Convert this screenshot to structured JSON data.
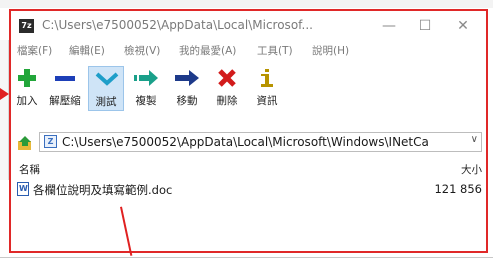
{
  "window": {
    "title": "C:\\Users\\e7500052\\AppData\\Local\\Microsof...",
    "app_icon_text": "7z",
    "minimize": "—",
    "maximize": "☐",
    "close": "✕"
  },
  "menu": {
    "items": [
      "檔案(F)",
      "編輯(E)",
      "檢視(V)",
      "我的最愛(A)",
      "工具(T)",
      "說明(H)"
    ]
  },
  "toolbar": {
    "buttons": [
      {
        "label": "加入",
        "icon": "plus-icon",
        "color": "#22a63a"
      },
      {
        "label": "解壓縮",
        "icon": "minus-icon",
        "color": "#1d3fb8"
      },
      {
        "label": "測試",
        "icon": "check-chevron-icon",
        "color": "#1e9ec9"
      },
      {
        "label": "複製",
        "icon": "copy-arrow-icon",
        "color": "#1aa08a"
      },
      {
        "label": "移動",
        "icon": "move-arrow-icon",
        "color": "#1d3a8a"
      },
      {
        "label": "刪除",
        "icon": "delete-x-icon",
        "color": "#d21b1b"
      },
      {
        "label": "資訊",
        "icon": "info-icon",
        "color": "#b79400"
      }
    ]
  },
  "address": {
    "path": "C:\\Users\\e7500052\\AppData\\Local\\Microsoft\\Windows\\INetCa",
    "dropdown": "∨"
  },
  "list": {
    "columns": {
      "name": "名稱",
      "size": "大小"
    },
    "rows": [
      {
        "name": "各欄位說明及填寫範例.doc",
        "size": "121 856"
      }
    ]
  },
  "colors": {
    "accent": "#e02828",
    "selection": "#cfe4f7"
  }
}
